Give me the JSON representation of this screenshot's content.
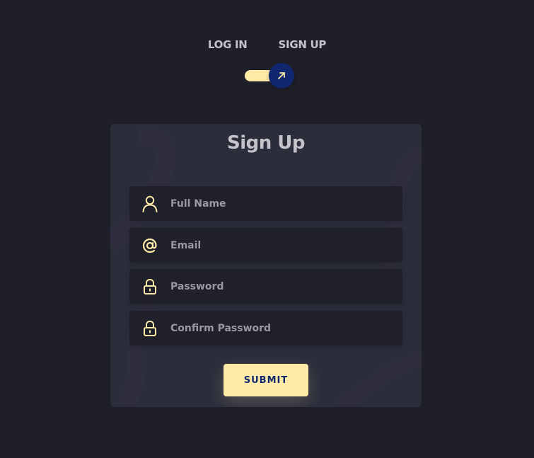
{
  "tabs": {
    "login_label": "LOG IN",
    "signup_label": "SIGN UP"
  },
  "toggle": {
    "state": "signup",
    "icon": "arrow-up-right-icon"
  },
  "form": {
    "title": "Sign Up",
    "fields": [
      {
        "icon": "user-icon",
        "placeholder": "Full Name",
        "value": ""
      },
      {
        "icon": "at-icon",
        "placeholder": "Email",
        "value": ""
      },
      {
        "icon": "lock-icon",
        "placeholder": "Password",
        "value": ""
      },
      {
        "icon": "lock-icon",
        "placeholder": "Confirm Password",
        "value": ""
      }
    ],
    "submit_label": "SUBMIT"
  },
  "colors": {
    "background": "#1f1f29",
    "card": "#2b2d3b",
    "field": "#1f2029",
    "accent": "#ffeba7",
    "knob": "#102770",
    "text": "#c4c3ca"
  }
}
